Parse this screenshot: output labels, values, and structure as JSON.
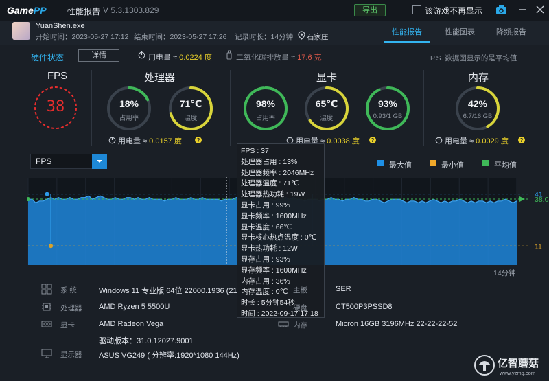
{
  "titlebar": {
    "logo": "GamePP",
    "title": "性能报告",
    "version": "V 5.3.1303.829",
    "export_label": "导出",
    "noshow_label": "该游戏不再显示"
  },
  "session": {
    "app_name": "YuanShen.exe",
    "start": "开始时间：2023-05-27 17:12",
    "end": "结束时间：2023-05-27 17:26",
    "duration": "记录时长：14分钟",
    "location": "石家庄"
  },
  "tabs": [
    "性能报告",
    "性能图表",
    "降频报告"
  ],
  "status": {
    "hw_status": "硬件状态",
    "detail_label": "详情",
    "power_prefix": "用电量 ≈ ",
    "power_value": "0.0224 度",
    "co2_prefix": "二氧化碳排放量 ≈ ",
    "co2_value": "17.6 克",
    "note": "P.S. 数据图显示的是平均值"
  },
  "sections": {
    "fps": {
      "title": "FPS",
      "value": "38"
    },
    "cpu": {
      "title": "处理器",
      "usage": {
        "value": "18%",
        "sub": "占用率",
        "pct": 0.18
      },
      "temp": {
        "value": "71℃",
        "sub": "温度",
        "pct": 0.71
      },
      "power_prefix": "用电量 ≈ ",
      "power_value": "0.0157 度"
    },
    "gpu": {
      "title": "显卡",
      "usage": {
        "value": "98%",
        "sub": "占用率",
        "pct": 0.98
      },
      "temp": {
        "value": "65℃",
        "sub": "温度",
        "pct": 0.65
      },
      "vram": {
        "value": "93%",
        "sub": "0.93/1 GB",
        "pct": 0.93
      },
      "power_prefix": "用电量 ≈ ",
      "power_value": "0.0038 度"
    },
    "mem": {
      "title": "内存",
      "usage": {
        "value": "42%",
        "sub": "6.7/16 GB",
        "pct": 0.42
      },
      "power_prefix": "用电量 ≈ ",
      "power_value": "0.0029 度"
    }
  },
  "colors": {
    "accent": "#33b4f0",
    "gauge_green": "#3fb858",
    "gauge_yellow": "#d8d43a",
    "fps_red": "#e62d2d",
    "chart_fill": "#1e7fd0",
    "chart_line": "#3fa5f0"
  },
  "chart_data": {
    "type": "area",
    "selected_metric": "FPS",
    "legend": [
      "最大值",
      "最小值",
      "平均值"
    ],
    "max_value": 41,
    "min_value": 11,
    "avg_value": 38.08,
    "max_label": "41",
    "min_label": "11",
    "avg_label": "38.08",
    "xlabel": "14分钟",
    "ylim": [
      0,
      50
    ],
    "values": [
      38,
      38,
      36,
      37,
      37,
      38,
      39,
      38,
      39,
      38,
      38,
      39,
      38,
      38,
      39,
      39,
      40,
      38,
      39,
      40,
      39,
      38,
      38,
      39,
      38,
      38,
      39,
      39,
      38,
      39,
      38,
      38,
      39,
      38,
      38,
      38,
      37,
      38,
      38,
      39,
      38,
      38,
      38,
      39,
      38,
      38,
      39,
      38,
      38,
      38,
      38,
      37,
      38,
      38,
      38,
      39,
      38,
      38,
      37,
      38,
      38,
      39,
      38,
      37,
      38,
      37,
      38,
      38,
      39,
      38,
      39,
      38,
      38,
      37,
      38,
      38,
      38,
      37,
      38,
      38,
      39,
      38,
      38,
      37,
      38,
      38,
      39,
      38,
      38,
      37,
      37,
      38,
      38,
      37,
      36,
      37,
      38,
      38,
      38,
      37,
      36,
      37,
      37,
      36,
      37,
      36,
      37,
      38,
      37,
      36,
      37,
      36,
      37,
      37,
      38,
      37,
      36,
      37,
      36,
      37,
      37,
      36,
      37,
      36,
      37,
      37,
      38,
      37,
      36,
      37
    ],
    "events": [
      {
        "index": 5,
        "value": 41
      },
      {
        "index": 6,
        "value": 11
      },
      {
        "index": 75,
        "value": 11
      }
    ]
  },
  "tooltip": [
    "FPS : 37",
    "处理器占用 : 13%",
    "处理器频率 : 2046MHz",
    "处理器温度 : 71℃",
    "处理器热功耗 : 19W",
    "显卡占用 : 99%",
    "显卡频率 : 1600MHz",
    "显卡温度 : 66℃",
    "显卡核心热点温度 : 0℃",
    "显卡热功耗 : 12W",
    "显存占用 : 93%",
    "显存频率 : 1600MHz",
    "内存占用 : 36%",
    "内存温度 : 0℃",
    "时长 : 5分钟54秒",
    "时间 : 2022-09-17 17:18"
  ],
  "info": {
    "system_label": "系    统",
    "system_value": "Windows 11 专业版 64位 22000.1936 (21",
    "cpu_label": "处理器",
    "cpu_value": "AMD Ryzen 5 5500U",
    "gpu_label": "显卡",
    "gpu_value": "AMD Radeon Vega",
    "driver_value": "驱动版本：31.0.12027.9001",
    "display_label": "显示器",
    "display_value": "ASUS VG249 ( 分辨率:1920*1080 144Hz)",
    "mb_label": "主板",
    "mb_value": "SER",
    "disk_label": "硬盘",
    "disk_value": "CT500P3PSSD8",
    "mem_label": "内存",
    "mem_value": "Micron 16GB 3196MHz 22-22-22-52"
  },
  "watermark": {
    "text": "亿智蘑菇",
    "url": "www.yzmg.com"
  }
}
